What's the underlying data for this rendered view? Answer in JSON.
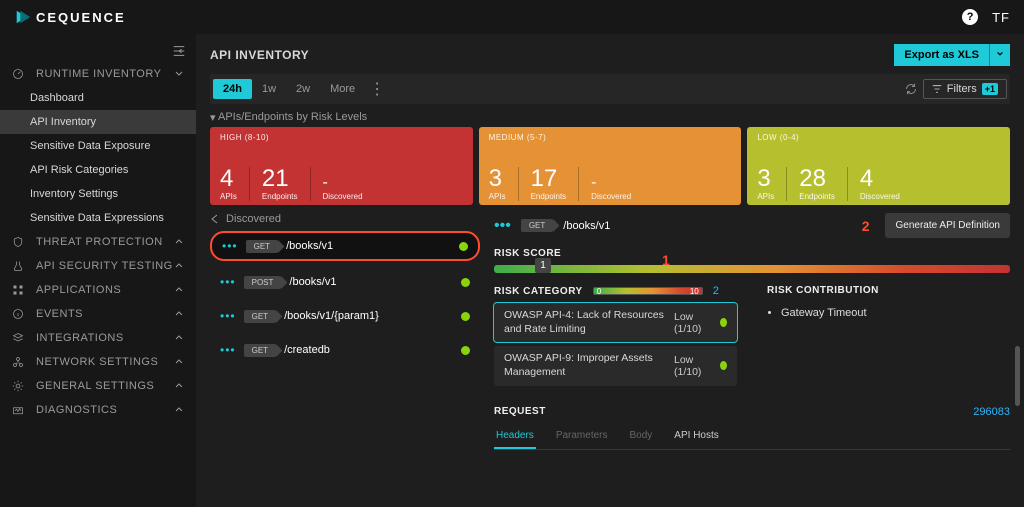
{
  "brand": "CEQUENCE",
  "user_initials": "TF",
  "sidebar": {
    "sections": [
      {
        "label": "RUNTIME INVENTORY",
        "icon": "gauge-icon",
        "expanded": true
      },
      {
        "label": "THREAT PROTECTION",
        "icon": "shield-icon"
      },
      {
        "label": "API SECURITY TESTING",
        "icon": "flask-icon"
      },
      {
        "label": "APPLICATIONS",
        "icon": "grid-icon"
      },
      {
        "label": "EVENTS",
        "icon": "info-icon"
      },
      {
        "label": "INTEGRATIONS",
        "icon": "layers-icon"
      },
      {
        "label": "NETWORK SETTINGS",
        "icon": "network-icon"
      },
      {
        "label": "GENERAL SETTINGS",
        "icon": "gear-icon"
      },
      {
        "label": "DIAGNOSTICS",
        "icon": "diagnostics-icon"
      }
    ],
    "runtime_items": [
      "Dashboard",
      "API Inventory",
      "Sensitive Data Exposure",
      "API Risk Categories",
      "Inventory Settings",
      "Sensitive Data Expressions"
    ],
    "active": "API Inventory"
  },
  "page_title": "API INVENTORY",
  "export_label": "Export as XLS",
  "time_ranges": [
    "24h",
    "1w",
    "2w",
    "More"
  ],
  "active_range": "24h",
  "filters_label": "Filters",
  "filters_count": "+1",
  "risk_header": "APIs/Endpoints by Risk Levels",
  "risk_cards": [
    {
      "label": "HIGH (8-10)",
      "apis": "4",
      "endpoints": "21",
      "discovered": "-"
    },
    {
      "label": "MEDIUM (5-7)",
      "apis": "3",
      "endpoints": "17",
      "discovered": "-"
    },
    {
      "label": "LOW (0-4)",
      "apis": "3",
      "endpoints": "28",
      "discovered": "4"
    }
  ],
  "metric_labels": {
    "apis": "APIs",
    "endpoints": "Endpoints",
    "discovered": "Discovered"
  },
  "discovered_label": "Discovered",
  "endpoints": [
    {
      "method": "GET",
      "path": "/books/v1",
      "selected": true
    },
    {
      "method": "POST",
      "path": "/books/v1"
    },
    {
      "method": "GET",
      "path": "/books/v1/{param1}"
    },
    {
      "method": "GET",
      "path": "/createdb"
    }
  ],
  "detail": {
    "method": "GET",
    "path": "/books/v1",
    "generate_label": "Generate API Definition",
    "risk_score_label": "RISK SCORE",
    "risk_score": "1",
    "risk_category_label": "RISK CATEGORY",
    "risk_cat_lo": "0",
    "risk_cat_hi": "10",
    "risk_cat_count": "2",
    "categories": [
      {
        "name": "OWASP API-4: Lack of Resources and Rate Limiting",
        "score": "Low (1/10)",
        "active": true
      },
      {
        "name": "OWASP API-9: Improper Assets Management",
        "score": "Low (1/10)"
      }
    ],
    "contribution_label": "RISK CONTRIBUTION",
    "contributions": [
      "Gateway Timeout"
    ],
    "request_label": "REQUEST",
    "request_count": "296083",
    "tabs": [
      "Headers",
      "Parameters",
      "Body",
      "API Hosts"
    ],
    "active_tab": "Headers"
  },
  "callouts": {
    "one": "1",
    "two": "2"
  }
}
